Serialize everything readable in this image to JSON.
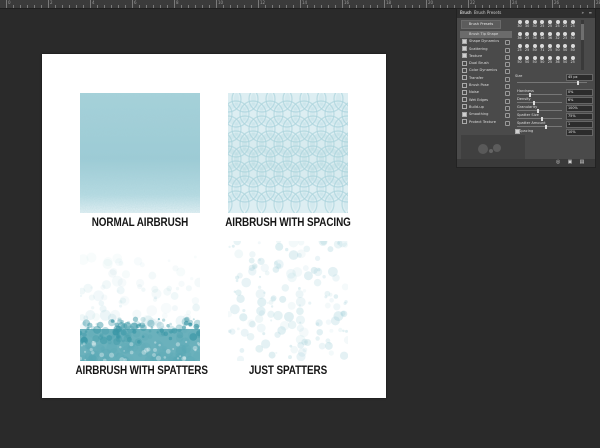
{
  "ruler": {
    "labels": [
      "0",
      "2",
      "4",
      "6",
      "8",
      "10",
      "12",
      "14",
      "16",
      "18",
      "20",
      "22",
      "24",
      "26",
      "28"
    ]
  },
  "samples": [
    {
      "caption": "NORMAL AIRBRUSH",
      "style": "airbrush"
    },
    {
      "caption": "AIRBRUSH WITH SPACING",
      "style": "spacing"
    },
    {
      "caption": "AIRBRUSH WITH SPATTERS",
      "style": "spatters"
    },
    {
      "caption": "JUST SPATTERS",
      "style": "just-spatters"
    }
  ],
  "colors": {
    "ink": "#3a97a6",
    "ink_light": "#a9d3dc",
    "ink_dark": "#1f7d8c"
  },
  "brush_panel": {
    "tabs": [
      "Brush",
      "Brush Presets"
    ],
    "presets_button": "Brush Presets",
    "options": [
      {
        "label": "Brush Tip Shape",
        "checked": false,
        "selected": true
      },
      {
        "label": "Shape Dynamics",
        "checked": true
      },
      {
        "label": "Scattering",
        "checked": true
      },
      {
        "label": "Texture",
        "checked": true
      },
      {
        "label": "Dual Brush",
        "checked": false
      },
      {
        "label": "Color Dynamics",
        "checked": false
      },
      {
        "label": "Transfer",
        "checked": false
      },
      {
        "label": "Brush Pose",
        "checked": false
      },
      {
        "label": "Noise",
        "checked": false
      },
      {
        "label": "Wet Edges",
        "checked": false
      },
      {
        "label": "Build-up",
        "checked": false
      },
      {
        "label": "Smoothing",
        "checked": true
      },
      {
        "label": "Protect Texture",
        "checked": false
      }
    ],
    "preset_sizes": [
      "30",
      "30",
      "30",
      "25",
      "25",
      "25",
      "25",
      "25",
      "36",
      "25",
      "36",
      "36",
      "36",
      "32",
      "25",
      "50",
      "25",
      "25",
      "50",
      "71",
      "25",
      "50",
      "50",
      "50",
      "50",
      "50",
      "50",
      "50",
      "25",
      "36",
      "50",
      "25"
    ],
    "controls": [
      {
        "label": "Size",
        "value": "45 px"
      },
      {
        "label": "Hardness",
        "value": "0%"
      },
      {
        "label": "Density",
        "value": "6%"
      },
      {
        "label": "Granularity",
        "value": "100%"
      },
      {
        "label": "Spatter Size",
        "value": "75%"
      },
      {
        "label": "Spatter Amount",
        "value": "1"
      },
      {
        "label": "Spacing",
        "value": "10%"
      }
    ]
  }
}
